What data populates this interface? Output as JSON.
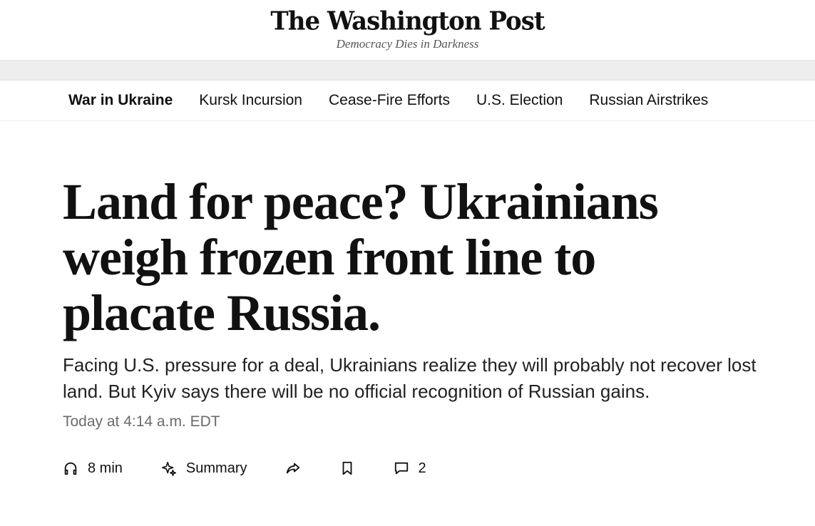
{
  "masthead": {
    "logo": "The Washington Post",
    "tagline": "Democracy Dies in Darkness"
  },
  "topic_nav": {
    "items": [
      {
        "label": "War in Ukraine",
        "active": true
      },
      {
        "label": "Kursk Incursion",
        "active": false
      },
      {
        "label": "Cease-Fire Efforts",
        "active": false
      },
      {
        "label": "U.S. Election",
        "active": false
      },
      {
        "label": "Russian Airstrikes",
        "active": false
      }
    ]
  },
  "article": {
    "headline": "Land for peace? Ukrainians weigh frozen front line to placate Russia.",
    "dek": "Facing U.S. pressure for a deal, Ukrainians realize they will probably not recover lost land. But Kyiv says there will be no official recognition of Russian gains.",
    "timestamp": "Today at 4:14 a.m. EDT"
  },
  "actions": {
    "listen": {
      "icon": "headphones-icon",
      "label": "8 min"
    },
    "summary": {
      "icon": "sparkle-icon",
      "label": "Summary"
    },
    "share": {
      "icon": "share-icon"
    },
    "save": {
      "icon": "bookmark-icon"
    },
    "comments": {
      "icon": "comment-icon",
      "count": "2"
    }
  }
}
